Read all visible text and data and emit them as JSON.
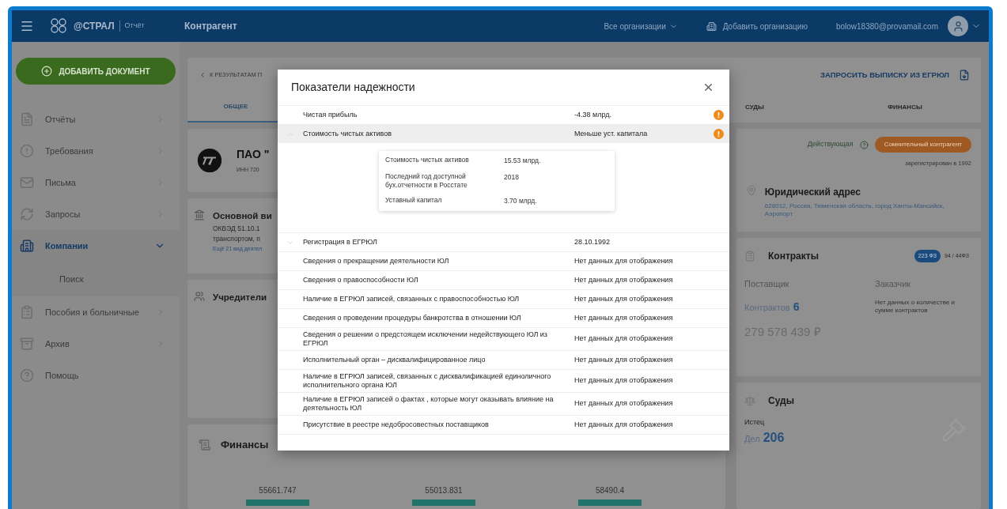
{
  "topbar": {
    "brand": "@СТРАЛ",
    "product": "Отчёт",
    "title": "Контрагент",
    "org_select": "Все организации",
    "add_org": "Добавить организацию",
    "email": "bolow18380@provamail.com"
  },
  "sidebar": {
    "add_button": "ДОБАВИТЬ ДОКУМЕНТ",
    "items": [
      {
        "label": "Отчёты",
        "selected": false,
        "expanded": false
      },
      {
        "label": "Требования",
        "selected": false,
        "expanded": false
      },
      {
        "label": "Письма",
        "selected": false,
        "expanded": false
      },
      {
        "label": "Запросы",
        "selected": false,
        "expanded": false
      },
      {
        "label": "Компании",
        "selected": true,
        "expanded": true,
        "children": [
          {
            "label": "Поиск"
          }
        ]
      },
      {
        "label": "Пособия и больничные",
        "selected": false,
        "expanded": false
      },
      {
        "label": "Архив",
        "selected": false,
        "expanded": false
      },
      {
        "label": "Помощь",
        "selected": false
      }
    ]
  },
  "page": {
    "back_link": "К РЕЗУЛЬТАТАМ П",
    "request_link": "ЗАПРОСИТЬ ВЫПИСКУ ИЗ ЕГРЮЛ",
    "tabs": [
      {
        "label": "ОБЩЕЕ",
        "selected": true
      },
      {
        "label": "СУДЫ",
        "selected": false
      },
      {
        "label": "ФИНАНСЫ",
        "selected": false
      }
    ],
    "company": {
      "name": "ПАО \"",
      "inn": "ИНН 720",
      "status": "Действующая",
      "risk_badge": "Сомнительный контрагент",
      "registered": "зарегистрирован в 1992"
    },
    "activity": {
      "title": "Основной ви",
      "lines": [
        "ОКВЭД 51.10.1",
        "транспортом, п"
      ],
      "more": "Ещё 21 вид деятел"
    },
    "founders": {
      "title": "Учредители"
    },
    "address": {
      "title": "Юридический адрес",
      "text": "628012, Россия, Тюменская область, город Ханты-Мансийск, Аэропорт"
    },
    "contracts": {
      "title": "Контракты",
      "laws": [
        {
          "label": "223 ФЗ",
          "selected": true
        },
        {
          "label": "94 / 44ФЗ",
          "selected": false
        }
      ],
      "supplier": "Поставщик",
      "customer": "Заказчик",
      "count_label": "Контрактов",
      "count": "6",
      "sum": "279 578 439 ₽",
      "customer_note": "Нет данных о количестве и сумме контрактов"
    },
    "finance": {
      "title": "Финансы",
      "bar_labels": [
        "55661.747",
        "55013.831",
        "58490.4"
      ]
    },
    "courts": {
      "title": "Суды",
      "role": "Истец",
      "cases_label": "Дел",
      "cases": "206"
    }
  },
  "modal": {
    "title": "Показатели надежности",
    "rows": [
      {
        "label": "Чистая прибыль",
        "value": "-4.38 млрд.",
        "warning": true,
        "expanded": null,
        "highlighted": false
      },
      {
        "label": "Стоимость чистых активов",
        "value": "Меньше уст. капитала",
        "warning": true,
        "expanded": true,
        "highlighted": true,
        "details": [
          {
            "label": "Стоимость чистых активов",
            "value": "15.53 млрд."
          },
          {
            "label": "Последний год доступной бух.отчетности в Росстате",
            "value": "2018"
          },
          {
            "label": "Уставный капитал",
            "value": "3.70 млрд."
          }
        ]
      },
      {
        "label": "Регистрация в ЕГРЮЛ",
        "value": "28.10.1992",
        "warning": false,
        "expanded": false,
        "highlighted": false
      },
      {
        "label": "Сведения о прекращении деятельности ЮЛ",
        "value": "Нет данных для отображения",
        "warning": false,
        "expanded": null,
        "highlighted": false
      },
      {
        "label": "Сведения о правоспособности ЮЛ",
        "value": "Нет данных для отображения",
        "warning": false,
        "expanded": null,
        "highlighted": false
      },
      {
        "label": "Наличие в ЕГРЮЛ записей, связанных с правоспособностью ЮЛ",
        "value": "Нет данных для отображения",
        "warning": false,
        "expanded": null,
        "highlighted": false
      },
      {
        "label": "Сведения о проведении процедуры банкротства в отношении ЮЛ",
        "value": "Нет данных для отображения",
        "warning": false,
        "expanded": null,
        "highlighted": false
      },
      {
        "label": "Сведения о решении о предстоящем исключении недействующего ЮЛ из ЕГРЮЛ",
        "value": "Нет данных для отображения",
        "warning": false,
        "expanded": null,
        "highlighted": false
      },
      {
        "label": "Исполнительный орган – дисквалифицированное лицо",
        "value": "Нет данных для отображения",
        "warning": false,
        "expanded": null,
        "highlighted": false
      },
      {
        "label": "Наличие в ЕГРЮЛ записей, связанных с дисквалификацией единоличного исполнительного органа ЮЛ",
        "value": "Нет данных для отображения",
        "warning": false,
        "expanded": null,
        "highlighted": false
      },
      {
        "label": "Наличие в ЕГРЮЛ записей о фактах , которые могут оказывать влияние на деятельность ЮЛ",
        "value": "Нет данных для отображения",
        "warning": false,
        "expanded": null,
        "highlighted": false
      },
      {
        "label": "Присутствие в реестре недобросовестных поставщиков",
        "value": "Нет данных для отображения",
        "warning": false,
        "expanded": null,
        "highlighted": false
      }
    ]
  }
}
